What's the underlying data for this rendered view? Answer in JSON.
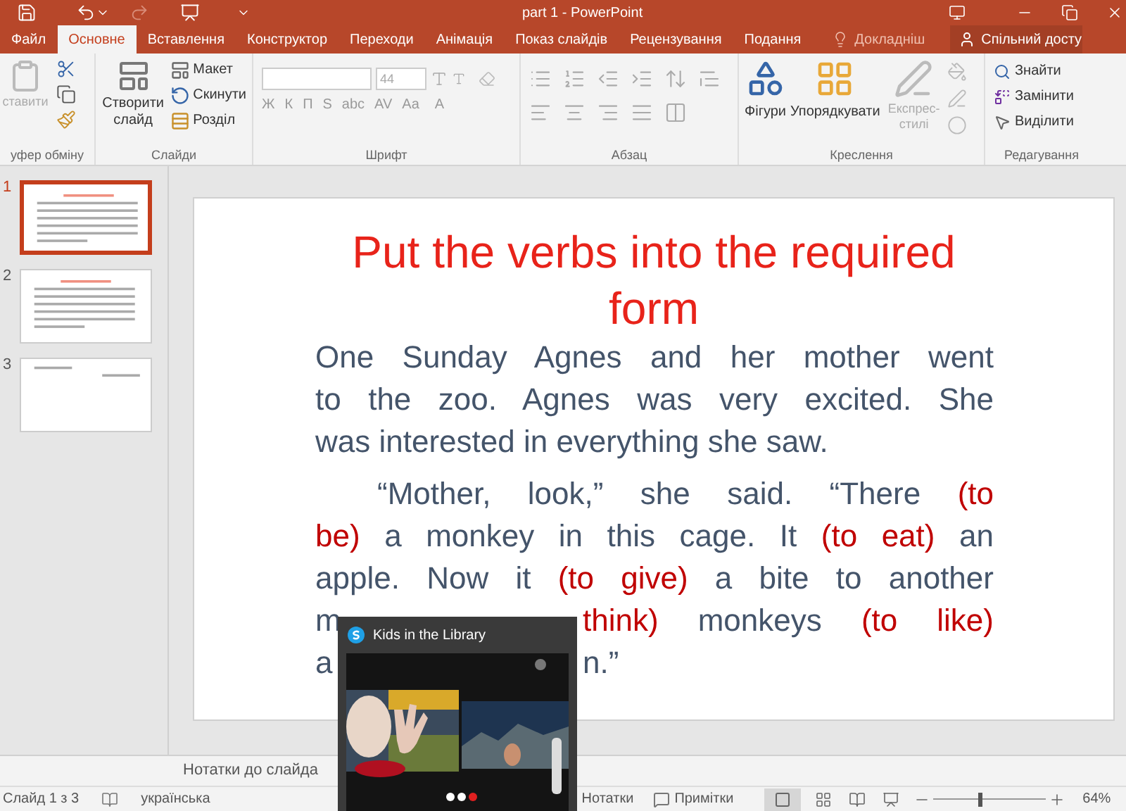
{
  "window": {
    "title": "part 1 - PowerPoint"
  },
  "tabs": [
    {
      "label": "Файл",
      "selected": false
    },
    {
      "label": "Основне",
      "selected": true
    },
    {
      "label": "Вставлення",
      "selected": false
    },
    {
      "label": "Конструктор",
      "selected": false
    },
    {
      "label": "Переходи",
      "selected": false
    },
    {
      "label": "Анімація",
      "selected": false
    },
    {
      "label": "Показ слайдів",
      "selected": false
    },
    {
      "label": "Рецензування",
      "selected": false
    },
    {
      "label": "Подання",
      "selected": false
    }
  ],
  "tell_me": "Докладніш",
  "share": "Спільний досту",
  "ribbon": {
    "clipboard": {
      "label": "уфер обміну",
      "paste": "ставити"
    },
    "slides": {
      "label": "Слайди",
      "new_slide": "Створити слайд",
      "layout": "Макет",
      "reset": "Скинути",
      "section": "Розділ"
    },
    "font": {
      "label": "Шрифт",
      "size": "44",
      "buttons": [
        "Ж",
        "К",
        "П",
        "S",
        "abc",
        "AV",
        "Aa"
      ],
      "color_button": "A"
    },
    "paragraph": {
      "label": "Абзац"
    },
    "drawing": {
      "label": "Креслення",
      "shapes": "Фігури",
      "arrange": "Упорядкувати",
      "quick_styles": "Експрес-стилі"
    },
    "editing": {
      "label": "Редагування",
      "find": "Знайти",
      "replace": "Замінити",
      "select": "Виділити"
    }
  },
  "thumbnails": [
    {
      "number": "1",
      "selected": true,
      "kind": "text"
    },
    {
      "number": "2",
      "selected": false,
      "kind": "text"
    },
    {
      "number": "3",
      "selected": false,
      "kind": "title"
    }
  ],
  "slide": {
    "title": "Put the verbs into the required form",
    "lines": [
      {
        "kind": "line",
        "segments": [
          {
            "text": "One Sunday Agnes and her mother went",
            "red": false
          }
        ]
      },
      {
        "kind": "line",
        "segments": [
          {
            "text": "to the zoo. Agnes was very excited. She",
            "red": false
          }
        ]
      },
      {
        "kind": "paragraph-end",
        "segments": [
          {
            "text": "was interested in everything she saw.",
            "red": false
          }
        ]
      },
      {
        "kind": "paragraph-start",
        "segments": [
          {
            "text": "“Mother, look,” she said. “There ",
            "red": false
          },
          {
            "text": "(to",
            "red": true
          }
        ]
      },
      {
        "kind": "line",
        "segments": [
          {
            "text": "be)",
            "red": true
          },
          {
            "text": " a monkey in this cage. It ",
            "red": false
          },
          {
            "text": "(to eat)",
            "red": true
          },
          {
            "text": " an",
            "red": false
          }
        ]
      },
      {
        "kind": "line",
        "segments": [
          {
            "text": "apple. Now it ",
            "red": false
          },
          {
            "text": "(to give)",
            "red": true
          },
          {
            "text": " a bite to another",
            "red": false
          }
        ]
      },
      {
        "kind": "covered",
        "left": [
          {
            "text": "m",
            "red": false
          }
        ],
        "right": [
          {
            "text": "think)",
            "red": true
          },
          {
            "text": " monkeys ",
            "red": false
          },
          {
            "text": "(to like)",
            "red": true
          }
        ]
      },
      {
        "kind": "covered-end",
        "left": [
          {
            "text": "a",
            "red": false
          }
        ],
        "right": [
          {
            "text": "n.”",
            "red": false
          }
        ]
      }
    ]
  },
  "call_window": {
    "title": "Kids in the Library"
  },
  "notes_placeholder": "Нотатки до слайда",
  "status_bar": {
    "slide": "Слайд 1 з 3",
    "language": "українська",
    "notes": "Нотатки",
    "comments": "Примітки",
    "zoom": "64%",
    "zoom_slider": {
      "level": 0.4
    }
  }
}
